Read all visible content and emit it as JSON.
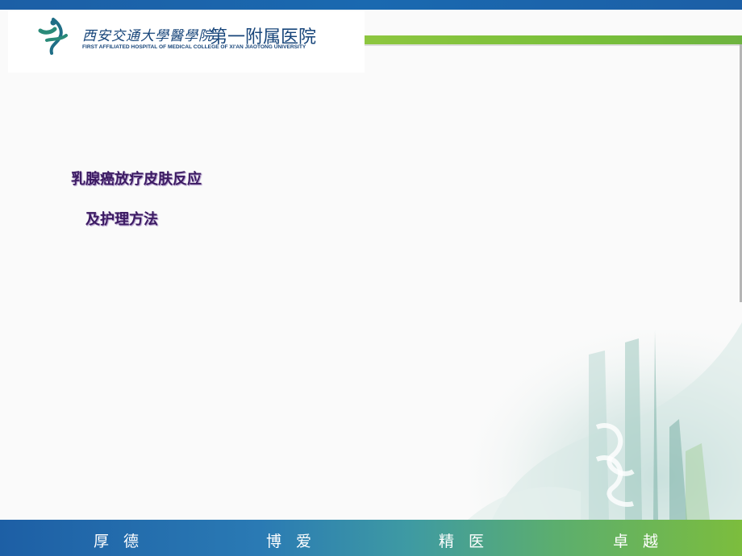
{
  "header": {
    "logo_icon": "hospital-logo-icon",
    "institution_script": "西安交通大學醫學院",
    "hospital_name": "第一附属医院",
    "english_name": "FIRST AFFILIATED HOSPITAL OF MEDICAL COLLEGE OF XI'AN JIAOTONG UNIVERSITY"
  },
  "slide": {
    "title_line1": "乳腺癌放疗皮肤反应",
    "title_line2": "及护理方法"
  },
  "footer": {
    "motto": [
      "厚德",
      "博爱",
      "精医",
      "卓越"
    ]
  },
  "colors": {
    "top_bar": "#1c5fa6",
    "accent_green": "#8dc63f",
    "title_text": "#3c1b63",
    "logo_text": "#17457a",
    "footer_start": "#1d5fa5",
    "footer_end": "#7cbd3d"
  }
}
